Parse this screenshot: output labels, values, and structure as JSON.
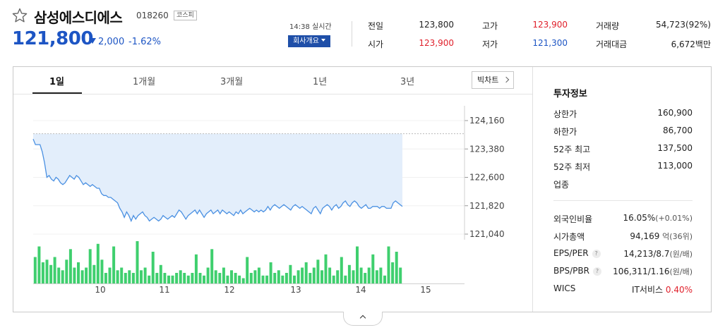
{
  "stock": {
    "name": "삼성에스디에스",
    "code": "018260",
    "market": "코스피",
    "price": "121,800",
    "change": "2,000",
    "change_pct": "-1.62%",
    "realtime": "14:38 실시간",
    "overview_button": "회사개요"
  },
  "quote": {
    "prev_close_label": "전일",
    "prev_close": "123,800",
    "open_label": "시가",
    "open": "123,900",
    "high_label": "고가",
    "high": "123,900",
    "low_label": "저가",
    "low": "121,300",
    "volume_label": "거래량",
    "volume": "54,723(92%)",
    "amount_label": "거래대금",
    "amount": "6,672백만"
  },
  "tabs": [
    "1일",
    "1개월",
    "3개월",
    "1년",
    "3년"
  ],
  "big_chart_button": "빅차트",
  "invest": {
    "title": "투자정보",
    "upper_label": "상한가",
    "upper": "160,900",
    "lower_label": "하한가",
    "lower": "86,700",
    "high52_label": "52주 최고",
    "high52": "137,500",
    "low52_label": "52주 최저",
    "low52": "113,000",
    "sector_label": "업종",
    "foreign_label": "외국인비율",
    "foreign": "16.05%",
    "foreign_chg": "(+0.01%)",
    "mcap_label": "시가총액",
    "mcap": "94,169",
    "mcap_unit": "억(36위)",
    "eps_label": "EPS/PER",
    "eps": "14,213/8.7",
    "eps_unit": "(원/배)",
    "bps_label": "BPS/PBR",
    "bps": "106,311/1.16",
    "bps_unit": "(원/배)",
    "wics_label": "WICS",
    "wics": "IT서비스",
    "wics_pct": "0.40%"
  },
  "colors": {
    "up": "#e0202b",
    "down": "#1d55c4",
    "line": "#4a90e2",
    "area": "#e3eefb",
    "volume": "#3fcf6e"
  },
  "chart_data": {
    "type": "line",
    "x_ticks": [
      "10",
      "11",
      "12",
      "13",
      "14",
      "15"
    ],
    "y_ticks": [
      124160,
      123380,
      122600,
      121820,
      121040
    ],
    "ylim": [
      121040,
      124160
    ],
    "reference": 123800,
    "series": [
      {
        "values": [
          123650,
          123500,
          123500,
          123500,
          123300,
          123000,
          122600,
          122650,
          122550,
          122500,
          122600,
          122550,
          122450,
          122400,
          122450,
          122550,
          122650,
          122600,
          122550,
          122650,
          122600,
          122500,
          122400,
          122450,
          122400,
          122350,
          122400,
          122350,
          122300,
          122300,
          122150,
          122100,
          122100,
          122050,
          122050,
          122000,
          121950,
          121900,
          121750,
          121650,
          121500,
          121650,
          121550,
          121400,
          121550,
          121450,
          121550,
          121600,
          121650,
          121550,
          121500,
          121400,
          121450,
          121500,
          121450,
          121400,
          121450,
          121550,
          121500,
          121450,
          121500,
          121550,
          121500,
          121600,
          121700,
          121650,
          121550,
          121450,
          121550,
          121600,
          121650,
          121700,
          121600,
          121700,
          121600,
          121500,
          121600,
          121650,
          121700,
          121600,
          121650,
          121700,
          121600,
          121700,
          121650,
          121600,
          121650,
          121600,
          121550,
          121650,
          121600,
          121700,
          121600,
          121650,
          121700,
          121750,
          121700,
          121650,
          121700,
          121650,
          121700,
          121650,
          121700,
          121800,
          121700,
          121800,
          121850,
          121800,
          121750,
          121800,
          121850,
          121800,
          121750,
          121700,
          121800,
          121850,
          121800,
          121750,
          121800,
          121750,
          121700,
          121650,
          121600,
          121750,
          121800,
          121700,
          121600,
          121750,
          121800,
          121850,
          121800,
          121700,
          121800,
          121850,
          121750,
          121800,
          121900,
          121950,
          121850,
          121800,
          121900,
          121950,
          121900,
          121800,
          121750,
          121800,
          121850,
          121750,
          121750,
          121800,
          121800,
          121800,
          121750,
          121800,
          121800,
          121750,
          121750,
          121750,
          121900,
          121950,
          121900,
          121850,
          121800
        ]
      }
    ],
    "volume": [
      10,
      14,
      8,
      9,
      7,
      10,
      6,
      5,
      9,
      13,
      6,
      8,
      5,
      6,
      13,
      7,
      15,
      9,
      4,
      6,
      14,
      5,
      6,
      4,
      5,
      4,
      16,
      5,
      6,
      3,
      12,
      4,
      7,
      4,
      3,
      3,
      4,
      5,
      4,
      3,
      4,
      11,
      4,
      3,
      6,
      13,
      5,
      4,
      6,
      3,
      5,
      4,
      3,
      2,
      10,
      4,
      5,
      6,
      3,
      3,
      8,
      4,
      5,
      3,
      4,
      7,
      3,
      5,
      6,
      8,
      4,
      6,
      9,
      5,
      11,
      6,
      3,
      5,
      10,
      3,
      7,
      5,
      14,
      6,
      4,
      6,
      11,
      5,
      6,
      3,
      14,
      8,
      12,
      6
    ]
  }
}
